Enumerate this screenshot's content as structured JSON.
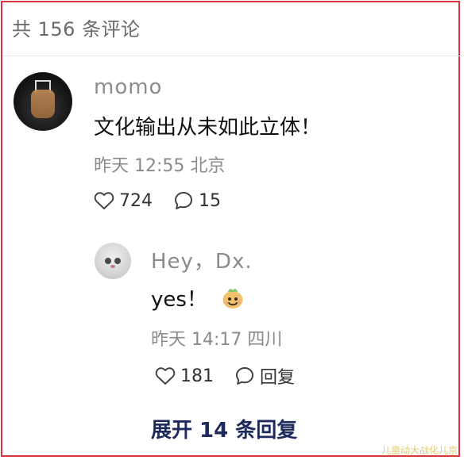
{
  "header": {
    "total_comments_label": "共 156 条评论"
  },
  "comment": {
    "username": "momo",
    "content": "文化输出从未如此立体！",
    "meta": "昨天 12:55 北京",
    "likes": "724",
    "replies": "15"
  },
  "reply": {
    "username": "Hey，Dx.",
    "content": "yes！",
    "meta": "昨天 14:17 四川",
    "likes": "181",
    "reply_label": "回复"
  },
  "expand_label": "展开 14 条回复",
  "watermark": "儿童动大战化儿京",
  "icons": {
    "like": "heart-icon",
    "comment": "comment-bubble-icon",
    "emoji": "happy-bird-emoji-icon"
  }
}
